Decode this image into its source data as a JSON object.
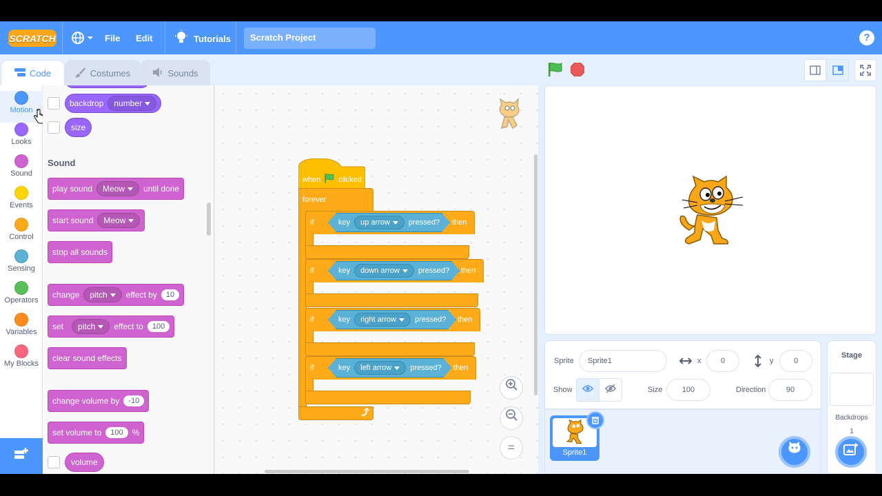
{
  "menubar": {
    "logo_text": "SCRATCH",
    "file": "File",
    "edit": "Edit",
    "tutorials": "Tutorials",
    "project_title": "Scratch Project",
    "help": "?"
  },
  "tabs": {
    "code": "Code",
    "costumes": "Costumes",
    "sounds": "Sounds"
  },
  "categories": [
    {
      "label": "Motion",
      "color": "#4c97ff"
    },
    {
      "label": "Looks",
      "color": "#9966ff"
    },
    {
      "label": "Sound",
      "color": "#cf63cf"
    },
    {
      "label": "Events",
      "color": "#ffd500"
    },
    {
      "label": "Control",
      "color": "#ffab19"
    },
    {
      "label": "Sensing",
      "color": "#5cb1d6"
    },
    {
      "label": "Operators",
      "color": "#59c059"
    },
    {
      "label": "Variables",
      "color": "#ff8c1a"
    },
    {
      "label": "My Blocks",
      "color": "#ff6680"
    }
  ],
  "flyout": {
    "backdrop_label": "backdrop",
    "backdrop_opt": "number",
    "size": "size",
    "sound_title": "Sound",
    "play_sound": "play sound",
    "play_sound_opt": "Meow",
    "until_done": "until done",
    "start_sound": "start sound",
    "start_sound_opt": "Meow",
    "stop_all": "stop all sounds",
    "change": "change",
    "pitch": "pitch",
    "effect_by": "effect by",
    "effect_by_val": "10",
    "set": "set",
    "effect_to": "effect to",
    "effect_to_val": "100",
    "clear_effects": "clear sound effects",
    "change_volume": "change volume by",
    "change_volume_val": "-10",
    "set_volume": "set volume to",
    "set_volume_val": "100",
    "percent": "%",
    "volume": "volume"
  },
  "script": {
    "when": "when",
    "clicked": "clicked",
    "forever": "forever",
    "if": "if",
    "key": "key",
    "pressed": "pressed?",
    "then": "then",
    "keys": [
      "up arrow",
      "down arrow",
      "right arrow",
      "left arrow"
    ]
  },
  "zoom": {
    "in": "+",
    "out": "−",
    "reset": "="
  },
  "sprite": {
    "label": "Sprite",
    "name": "Sprite1",
    "x_label": "x",
    "x": "0",
    "y_label": "y",
    "y": "0",
    "show": "Show",
    "size_label": "Size",
    "size": "100",
    "direction_label": "Direction",
    "direction": "90",
    "thumb_name": "Sprite1"
  },
  "stage_panel": {
    "title": "Stage",
    "backdrops": "Backdrops",
    "count": "1"
  }
}
